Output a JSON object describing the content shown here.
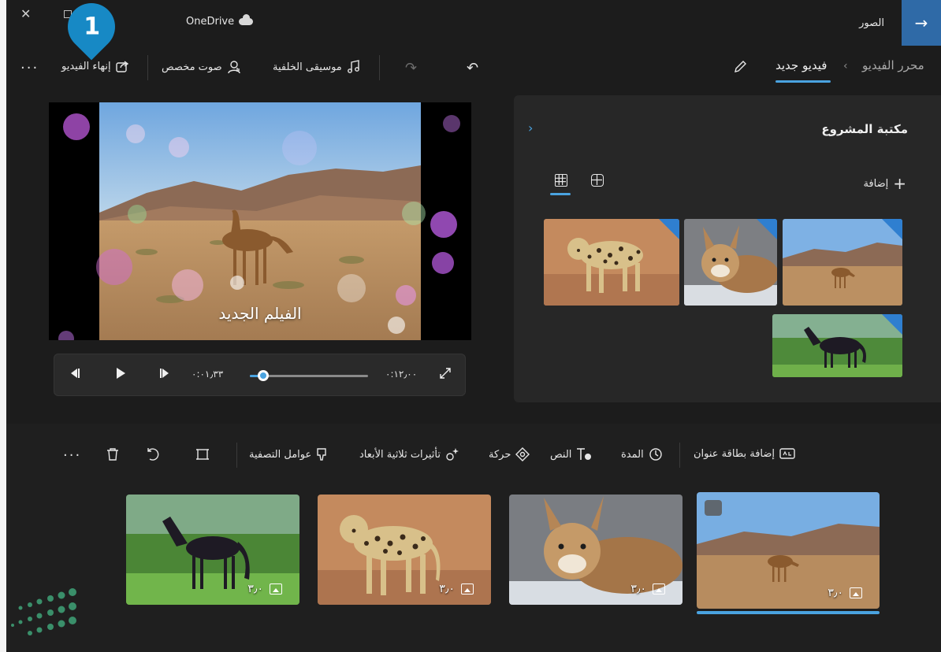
{
  "titlebar": {
    "onedrive": "OneDrive",
    "app_name": "الصور"
  },
  "marker": {
    "number": "1"
  },
  "toolbar": {
    "finish_video": "إنهاء الفيديو",
    "custom_audio": "صوت مخصص",
    "background_music": "موسيقى الخلفية",
    "breadcrumb_parent": "محرر الفيديو",
    "breadcrumb_current": "فيديو جديد"
  },
  "preview": {
    "title_overlay": "الفيلم الجديد"
  },
  "player": {
    "current_time": "٠:٠١٫٣٣",
    "total_time": "٠:١٢٫٠٠",
    "progress": 0.11
  },
  "library": {
    "title": "مكتبة المشروع",
    "add_label": "إضافة"
  },
  "storyboard_toolbar": {
    "add_title_card": "إضافة بطاقة عنوان",
    "duration": "المدة",
    "text": "النص",
    "motion": "حركة",
    "effects_3d": "تأثيرات ثلاثية الأبعاد",
    "filters": "عوامل التصفية"
  },
  "storyboard": {
    "cards": [
      {
        "subject": "camel",
        "duration": "٣٫٠",
        "selected": true
      },
      {
        "subject": "caracal",
        "duration": "٣٫٠",
        "selected": false
      },
      {
        "subject": "leopard",
        "duration": "٣٫٠",
        "selected": false
      },
      {
        "subject": "horse",
        "duration": "٣٫٠",
        "selected": false
      }
    ]
  },
  "colors": {
    "accent": "#4aa3e0",
    "back_button": "#2f6aa7",
    "marker": "#1789c5"
  }
}
